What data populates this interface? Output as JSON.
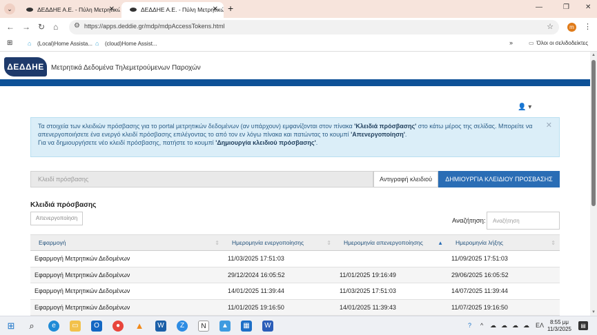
{
  "browser": {
    "tabs": [
      {
        "title": "ΔΕΔΔΗΕ Α.Ε. - Πύλη Μετρητικώ",
        "active": false
      },
      {
        "title": "ΔΕΔΔΗΕ Α.Ε. - Πύλη Μετρητικώ",
        "active": true
      }
    ],
    "url_prefix": "https://",
    "url": "apps.deddie.gr/mdp/mdpAccessTokens.html",
    "profile_initial": "m",
    "bookmarks": [
      "(Local)Home Assista...",
      "(cloud)Home Assist..."
    ],
    "all_bookmarks": "Όλοι οι σελιδοδείκτες"
  },
  "page": {
    "logo_text": "ΔΕΔΔΗΕ",
    "site_title": "Μετρητικά Δεδομένα Τηλεμετρούμενων Παροχών",
    "alert": {
      "line1_a": "Τα στοιχεία των κλειδιών πρόσβασης για το portal μετρητικών δεδομένων (αν υπάρχουν) εμφανίζονται στον πίνακα ",
      "line1_b": "'Κλειδιά πρόσβασης'",
      "line1_c": " στο κάτω μέρος της σελίδας. Μπορείτε να απενεργοποιήσετε ένα ενεργό κλειδί πρόσβασης επιλέγοντας το από τον εν λόγω πίνακα και πατώντας το κουμπί ",
      "line1_d": "'Απενεργοποίηση'",
      "line1_e": ".",
      "line2_a": "Για να δημιουργήσετε νέο κλειδί πρόσβασης, πατήστε το κουμπί ",
      "line2_b": "'Δημιουργία κλειδιού πρόσβασης'",
      "line2_c": "."
    },
    "token_placeholder": "Κλειδί πρόσβασης",
    "copy_button": "Αντιγραφή κλειδιού",
    "create_button": "ΔΗΜΙΟΥΡΓΙΑ ΚΛΕΙΔΙΟΥ ΠΡΟΣΒΑΣΗΣ",
    "section_title": "Κλειδιά πρόσβασης",
    "deactivate_button": "Απενεργοποίηση",
    "search_label": "Αναζήτηση:",
    "search_placeholder": "Αναζήτηση",
    "table": {
      "headers": [
        "Εφαρμογή",
        "Ημερομηνία ενεργοποίησης",
        "Ημερομηνία απενεργοποίησης",
        "Ημερομηνία λήξης"
      ],
      "rows": [
        [
          "Εφαρμογή Μετρητικών Δεδομένων",
          "11/03/2025 17:51:03",
          "",
          "11/09/2025 17:51:03"
        ],
        [
          "Εφαρμογή Μετρητικών Δεδομένων",
          "29/12/2024 16:05:52",
          "11/01/2025 19:16:49",
          "29/06/2025 16:05:52"
        ],
        [
          "Εφαρμογή Μετρητικών Δεδομένων",
          "14/01/2025 11:39:44",
          "11/03/2025 17:51:03",
          "14/07/2025 11:39:44"
        ],
        [
          "Εφαρμογή Μετρητικών Δεδομένων",
          "11/01/2025 19:16:50",
          "14/01/2025 11:39:43",
          "11/07/2025 19:16:50"
        ]
      ]
    }
  },
  "taskbar": {
    "lang": "ΕΛ",
    "time": "8:55 μμ",
    "date": "11/3/2025"
  }
}
